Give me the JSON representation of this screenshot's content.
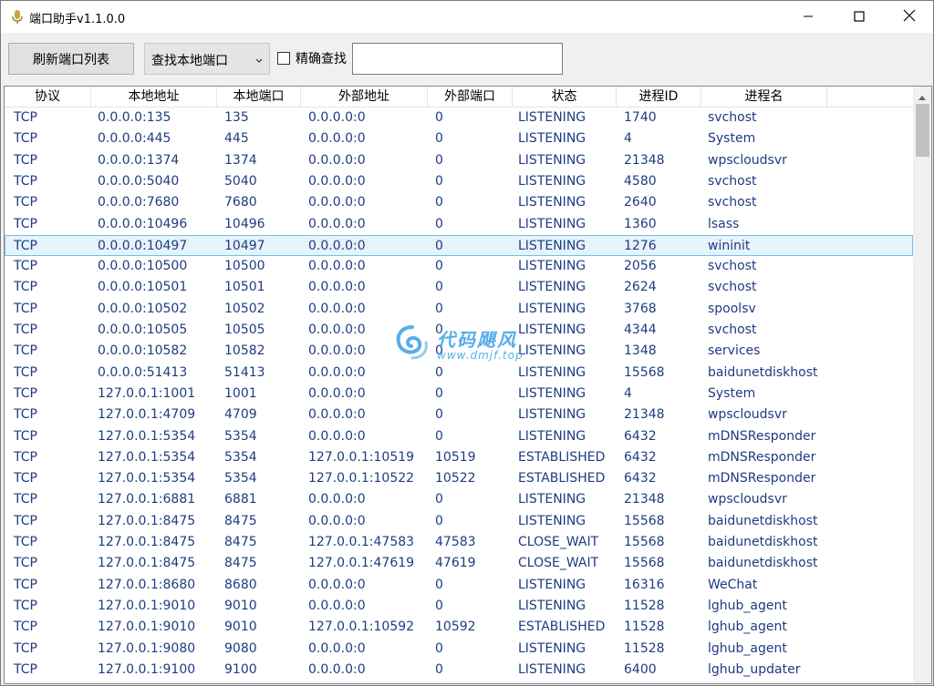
{
  "window": {
    "title": "端口助手v1.1.0.0"
  },
  "toolbar": {
    "refresh_label": "刷新端口列表",
    "search_mode": "查找本地端口",
    "exact_label": "精确查找",
    "search_value": ""
  },
  "columns": [
    "协议",
    "本地地址",
    "本地端口",
    "外部地址",
    "外部端口",
    "状态",
    "进程ID",
    "进程名"
  ],
  "selected_row": 6,
  "rows": [
    [
      "TCP",
      "0.0.0.0:135",
      "135",
      "0.0.0.0:0",
      "0",
      "LISTENING",
      "1740",
      "svchost"
    ],
    [
      "TCP",
      "0.0.0.0:445",
      "445",
      "0.0.0.0:0",
      "0",
      "LISTENING",
      "4",
      "System"
    ],
    [
      "TCP",
      "0.0.0.0:1374",
      "1374",
      "0.0.0.0:0",
      "0",
      "LISTENING",
      "21348",
      "wpscloudsvr"
    ],
    [
      "TCP",
      "0.0.0.0:5040",
      "5040",
      "0.0.0.0:0",
      "0",
      "LISTENING",
      "4580",
      "svchost"
    ],
    [
      "TCP",
      "0.0.0.0:7680",
      "7680",
      "0.0.0.0:0",
      "0",
      "LISTENING",
      "2640",
      "svchost"
    ],
    [
      "TCP",
      "0.0.0.0:10496",
      "10496",
      "0.0.0.0:0",
      "0",
      "LISTENING",
      "1360",
      "lsass"
    ],
    [
      "TCP",
      "0.0.0.0:10497",
      "10497",
      "0.0.0.0:0",
      "0",
      "LISTENING",
      "1276",
      "wininit"
    ],
    [
      "TCP",
      "0.0.0.0:10500",
      "10500",
      "0.0.0.0:0",
      "0",
      "LISTENING",
      "2056",
      "svchost"
    ],
    [
      "TCP",
      "0.0.0.0:10501",
      "10501",
      "0.0.0.0:0",
      "0",
      "LISTENING",
      "2624",
      "svchost"
    ],
    [
      "TCP",
      "0.0.0.0:10502",
      "10502",
      "0.0.0.0:0",
      "0",
      "LISTENING",
      "3768",
      "spoolsv"
    ],
    [
      "TCP",
      "0.0.0.0:10505",
      "10505",
      "0.0.0.0:0",
      "0",
      "LISTENING",
      "4344",
      "svchost"
    ],
    [
      "TCP",
      "0.0.0.0:10582",
      "10582",
      "0.0.0.0:0",
      "0",
      "LISTENING",
      "1348",
      "services"
    ],
    [
      "TCP",
      "0.0.0.0:51413",
      "51413",
      "0.0.0.0:0",
      "0",
      "LISTENING",
      "15568",
      "baidunetdiskhost"
    ],
    [
      "TCP",
      "127.0.0.1:1001",
      "1001",
      "0.0.0.0:0",
      "0",
      "LISTENING",
      "4",
      "System"
    ],
    [
      "TCP",
      "127.0.0.1:4709",
      "4709",
      "0.0.0.0:0",
      "0",
      "LISTENING",
      "21348",
      "wpscloudsvr"
    ],
    [
      "TCP",
      "127.0.0.1:5354",
      "5354",
      "0.0.0.0:0",
      "0",
      "LISTENING",
      "6432",
      "mDNSResponder"
    ],
    [
      "TCP",
      "127.0.0.1:5354",
      "5354",
      "127.0.0.1:10519",
      "10519",
      "ESTABLISHED",
      "6432",
      "mDNSResponder"
    ],
    [
      "TCP",
      "127.0.0.1:5354",
      "5354",
      "127.0.0.1:10522",
      "10522",
      "ESTABLISHED",
      "6432",
      "mDNSResponder"
    ],
    [
      "TCP",
      "127.0.0.1:6881",
      "6881",
      "0.0.0.0:0",
      "0",
      "LISTENING",
      "21348",
      "wpscloudsvr"
    ],
    [
      "TCP",
      "127.0.0.1:8475",
      "8475",
      "0.0.0.0:0",
      "0",
      "LISTENING",
      "15568",
      "baidunetdiskhost"
    ],
    [
      "TCP",
      "127.0.0.1:8475",
      "8475",
      "127.0.0.1:47583",
      "47583",
      "CLOSE_WAIT",
      "15568",
      "baidunetdiskhost"
    ],
    [
      "TCP",
      "127.0.0.1:8475",
      "8475",
      "127.0.0.1:47619",
      "47619",
      "CLOSE_WAIT",
      "15568",
      "baidunetdiskhost"
    ],
    [
      "TCP",
      "127.0.0.1:8680",
      "8680",
      "0.0.0.0:0",
      "0",
      "LISTENING",
      "16316",
      "WeChat"
    ],
    [
      "TCP",
      "127.0.0.1:9010",
      "9010",
      "0.0.0.0:0",
      "0",
      "LISTENING",
      "11528",
      "lghub_agent"
    ],
    [
      "TCP",
      "127.0.0.1:9010",
      "9010",
      "127.0.0.1:10592",
      "10592",
      "ESTABLISHED",
      "11528",
      "lghub_agent"
    ],
    [
      "TCP",
      "127.0.0.1:9080",
      "9080",
      "0.0.0.0:0",
      "0",
      "LISTENING",
      "11528",
      "lghub_agent"
    ],
    [
      "TCP",
      "127.0.0.1:9100",
      "9100",
      "0.0.0.0:0",
      "0",
      "LISTENING",
      "6400",
      "lghub_updater"
    ]
  ],
  "watermark": {
    "title": "代码飓风",
    "url": "www.dmjf.top"
  },
  "colors": {
    "cell_text": "#1f3b82",
    "selection_bg": "#e5f3fb",
    "selection_border": "#70c0e7",
    "watermark": "#3aa0e6"
  },
  "icons": {
    "app": "microphone-icon",
    "minimize": "minimize-icon",
    "maximize": "maximize-icon",
    "close": "close-icon",
    "dropdown": "chevron-down-icon",
    "scroll_up": "arrow-up-icon",
    "watermark": "cyclone-icon"
  }
}
